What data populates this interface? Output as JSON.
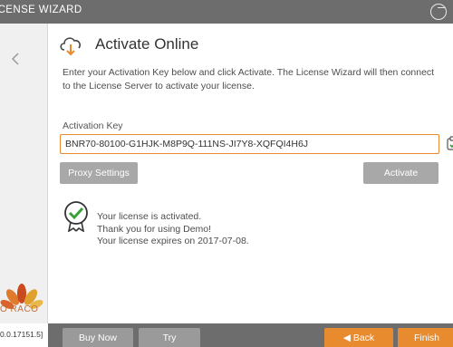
{
  "window": {
    "title": "ICENSE WIZARD"
  },
  "sidebar": {
    "logo_text": "O RACO",
    "version": "0.0.17151.5]"
  },
  "main": {
    "title": "Activate Online",
    "intro": "Enter your Activation Key below and click Activate. The License Wizard will then connect to the License Server to activate your license.",
    "key_label": "Activation Key",
    "key_value": "BNR70-80100-G1HJK-M8P9Q-111NS-JI7Y8-XQFQI4H6J",
    "proxy_button": "Proxy Settings",
    "activate_button": "Activate",
    "status": {
      "line1": "Your license is activated.",
      "line2": "Thank you for using Demo!",
      "line3": "Your license expires on 2017-07-08."
    }
  },
  "footer": {
    "buy_now": "Buy Now",
    "try": "Try",
    "back": "Back",
    "finish": "Finish"
  },
  "colors": {
    "accent": "#e88a2e",
    "bar": "#6d6d6d",
    "button": "#a8a8a8"
  }
}
